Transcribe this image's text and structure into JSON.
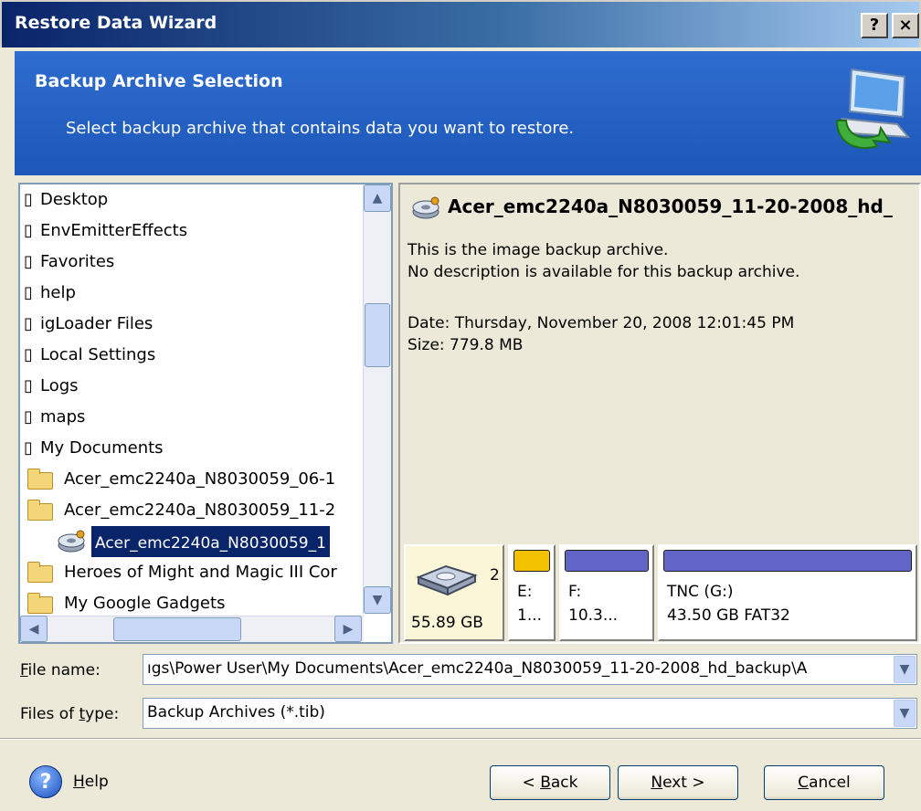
{
  "window": {
    "title": "Restore Data Wizard",
    "help_button": "?",
    "close_button": "×"
  },
  "banner": {
    "heading": "Backup Archive Selection",
    "subheading": "Select backup archive that contains data you want to restore."
  },
  "tree": {
    "plain_items": [
      "Desktop",
      "EnvEmitterEffects",
      "Favorites",
      "help",
      "igLoader Files",
      "Local Settings",
      "Logs",
      "maps",
      "My Documents"
    ],
    "folder_items": [
      "Acer_emc2240a_N8030059_06-1",
      "Acer_emc2240a_N8030059_11-2"
    ],
    "selected_item": "Acer_emc2240a_N8030059_1",
    "folder_items_after": [
      "Heroes of Might and Magic III Cor",
      "My Google Gadgets"
    ]
  },
  "info": {
    "archive_name": "Acer_emc2240a_N8030059_11-20-2008_hd_",
    "desc1": "This is the image backup archive.",
    "desc2": "No description is available for this backup archive.",
    "date": "Date: Thursday, November 20, 2008 12:01:45 PM",
    "size": "Size: 779.8 MB"
  },
  "diskmap": {
    "disk_number": "2",
    "disk_size": "55.89 GB",
    "partitions": [
      {
        "line1": "E:",
        "line2": "1...",
        "color": "#f2c100"
      },
      {
        "line1": "F:",
        "line2": "10.3...",
        "color": "#6264c8"
      },
      {
        "line1": "TNC (G:)",
        "line2": "43.50 GB  FAT32",
        "color": "#6264c8"
      }
    ]
  },
  "file_name": {
    "label_pre": "",
    "label_u": "F",
    "label_post": "ile name:",
    "value": "ıgs\\Power User\\My Documents\\Acer_emc2240a_N8030059_11-20-2008_hd_backup\\A"
  },
  "file_type": {
    "label_pre": "Files of ",
    "label_u": "t",
    "label_post": "ype:",
    "value": "Backup Archives (*.tib)"
  },
  "buttons": {
    "help_u": "H",
    "help_rest": "elp",
    "back_pre": "< ",
    "back_u": "B",
    "back_post": "ack",
    "next_u": "N",
    "next_post": "ext >",
    "cancel_u": "C",
    "cancel_post": "ancel"
  }
}
